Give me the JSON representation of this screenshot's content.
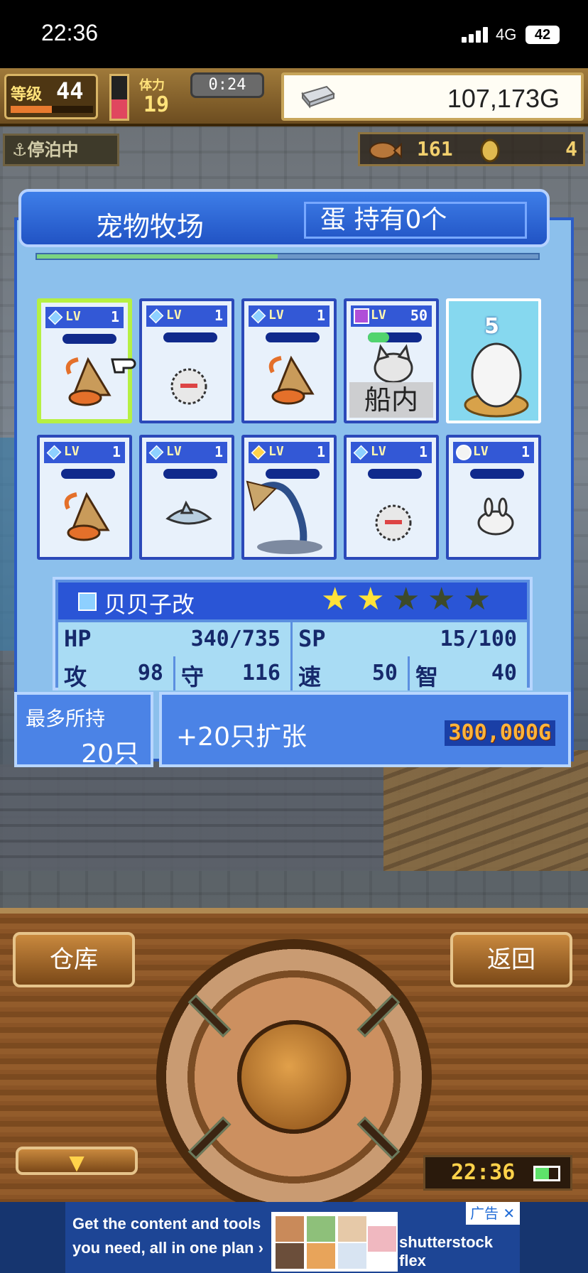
{
  "status_bar": {
    "time": "22:36",
    "network": "4G",
    "battery": "42"
  },
  "hud": {
    "level_label": "等级",
    "level": "44",
    "stamina_label": "体力",
    "stamina": "19",
    "timer": "0:24",
    "gold": "107,173G",
    "docked": "⚓停泊中",
    "item_left": "161",
    "item_right": "4"
  },
  "ranch": {
    "title": "宠物牧场",
    "egg_status": "蛋 持有0个",
    "pets": [
      {
        "lv_label": "LV",
        "level": "1",
        "gem": "blue",
        "creature": "hermit-crab",
        "selected": true
      },
      {
        "lv_label": "LV",
        "level": "1",
        "gem": "blue",
        "creature": "spiky-ball"
      },
      {
        "lv_label": "LV",
        "level": "1",
        "gem": "blue",
        "creature": "hermit-crab"
      },
      {
        "lv_label": "LV",
        "level": "50",
        "gem": "purple",
        "creature": "white-cat",
        "tag": "船内"
      },
      {
        "egg_count": "5",
        "creature": "egg"
      },
      {
        "lv_label": "LV",
        "level": "1",
        "gem": "blue",
        "creature": "hermit-crab"
      },
      {
        "lv_label": "LV",
        "level": "1",
        "gem": "blue",
        "creature": "shark"
      },
      {
        "lv_label": "LV",
        "level": "1",
        "gem": "gold",
        "creature": "phoenix"
      },
      {
        "lv_label": "LV",
        "level": "1",
        "gem": "blue",
        "creature": "spiky-ball"
      },
      {
        "lv_label": "LV",
        "level": "1",
        "gem": "white",
        "creature": "white-rabbit"
      }
    ],
    "selected_pet": {
      "name": "贝贝子改",
      "stars_filled": 2,
      "stars_total": 5,
      "hp_label": "HP",
      "hp": "340/735",
      "sp_label": "SP",
      "sp": "15/100",
      "atk_label": "攻",
      "atk": "98",
      "def_label": "守",
      "def": "116",
      "spd_label": "速",
      "spd": "50",
      "int_label": "智",
      "int": "40"
    },
    "capacity_label": "最多所持",
    "capacity_value": "20只",
    "expand_label": "+20只扩张",
    "expand_price": "300,000G"
  },
  "controls": {
    "warehouse": "仓库",
    "back": "返回",
    "clock": "22:36"
  },
  "ad": {
    "line1": "Get the content and tools",
    "line2": "you need, all in one plan  ›",
    "tag": "广告",
    "close": "✕",
    "brand": "shutterstock flex"
  },
  "colors": {
    "panel_blue": "#2b5cc6",
    "selection_green": "#b6f043",
    "gold_text": "#ffd24a"
  }
}
